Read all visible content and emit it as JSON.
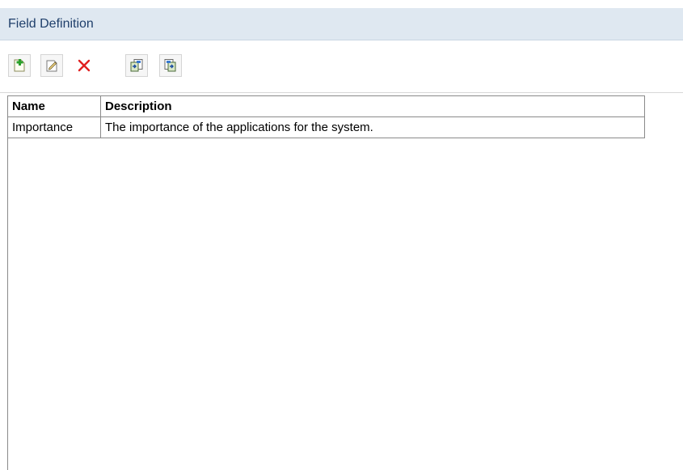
{
  "header": {
    "title": "Field Definition"
  },
  "toolbar": {
    "buttons": [
      {
        "name": "add",
        "icon": "add-document-icon"
      },
      {
        "name": "edit",
        "icon": "edit-document-icon"
      },
      {
        "name": "delete",
        "icon": "delete-icon"
      },
      {
        "name": "import",
        "icon": "import-icon"
      },
      {
        "name": "export",
        "icon": "export-icon"
      }
    ]
  },
  "table": {
    "columns": [
      "Name",
      "Description"
    ],
    "rows": [
      [
        "Importance",
        "The importance of the applications for the system."
      ]
    ]
  },
  "colors": {
    "header_bg": "#dfe8f1",
    "header_text": "#1f3f6b",
    "delete_red": "#e02020",
    "add_green": "#2aa02a"
  }
}
